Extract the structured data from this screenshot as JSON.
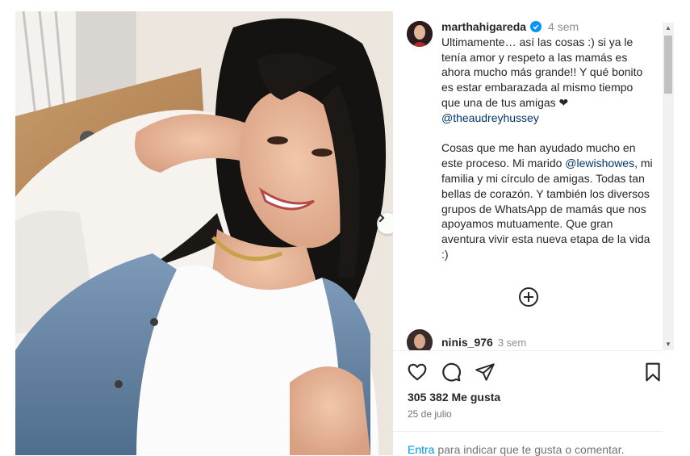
{
  "post": {
    "username": "marthahigareda",
    "time_ago": "4 sem",
    "caption_parts": {
      "p1": "Ultimamente… así las cosas :) si ya le tenía amor y respeto a las mamás es ahora mucho más grande!! Y qué bonito es estar embarazada al mismo tiempo que una de tus amigas ❤ ",
      "mention1": "@theaudreyhussey",
      "p2": "\n\nCosas que me han ayudado mucho en este proceso. Mi marido ",
      "mention2": "@lewishowes",
      "p3": ", mi familia y mi círculo de amigas. Todas tan bellas de corazón. Y también los diversos grupos de WhatsApp de mamás que nos apoyamos mutuamente. Que gran aventura vivir esta nueva etapa de la vida :)"
    },
    "likes": "305 382 Me gusta",
    "date": "25 de julio"
  },
  "comment": {
    "username": "ninis_976",
    "time_ago": "3 sem"
  },
  "login_prompt": {
    "link": "Entra",
    "text": " para indicar que te gusta o comentar."
  },
  "carousel": {
    "slides": 4,
    "active_index": 0
  },
  "icons": {
    "like": "heart-icon",
    "comment": "comment-icon",
    "share": "share-icon",
    "save": "bookmark-icon",
    "more": "plus-circle-icon",
    "verified": "verified-badge-icon",
    "next": "chevron-right-icon"
  },
  "colors": {
    "link": "#0095f6",
    "mention": "#00376b",
    "verified": "#0095f6",
    "secondary_text": "#737373"
  }
}
